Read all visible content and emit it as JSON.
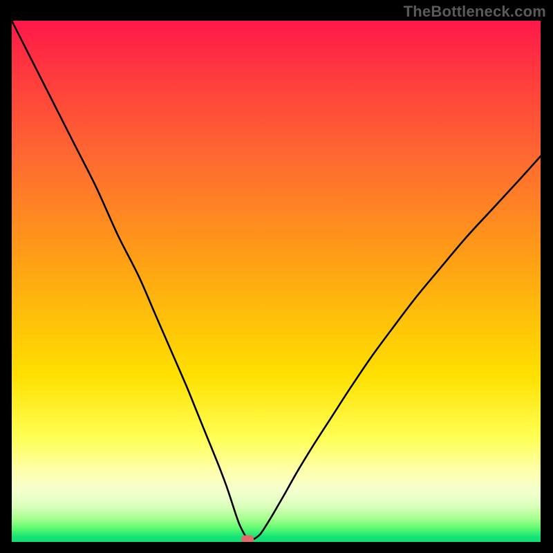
{
  "watermark": "TheBottleneck.com",
  "chart_data": {
    "type": "line",
    "title": "",
    "xlabel": "",
    "ylabel": "",
    "xlim": [
      0,
      100
    ],
    "ylim": [
      0,
      100
    ],
    "legend": false,
    "grid": false,
    "background_gradient": {
      "orientation": "vertical",
      "stops": [
        {
          "pos": 0.0,
          "color": "#ff184a"
        },
        {
          "pos": 0.12,
          "color": "#ff3f3c"
        },
        {
          "pos": 0.28,
          "color": "#ff6e2f"
        },
        {
          "pos": 0.46,
          "color": "#ffa015"
        },
        {
          "pos": 0.68,
          "color": "#ffe000"
        },
        {
          "pos": 0.8,
          "color": "#ffff55"
        },
        {
          "pos": 0.86,
          "color": "#ffffa8"
        },
        {
          "pos": 0.9,
          "color": "#f5ffcf"
        },
        {
          "pos": 0.93,
          "color": "#ddffbe"
        },
        {
          "pos": 0.955,
          "color": "#a8ff8f"
        },
        {
          "pos": 0.975,
          "color": "#59f96f"
        },
        {
          "pos": 0.99,
          "color": "#14e378"
        },
        {
          "pos": 1.0,
          "color": "#11df73"
        }
      ]
    },
    "series": [
      {
        "name": "bottleneck-curve",
        "color": "#000000",
        "x": [
          0,
          4,
          8,
          12,
          16,
          20,
          24,
          27,
          30,
          33,
          35,
          37,
          39,
          40.5,
          41.5,
          42.3,
          43.0,
          43.6,
          44.1,
          44.5,
          45.0,
          45.6,
          46.2,
          47.0,
          48.0,
          49.5,
          51.5,
          54.0,
          57.0,
          60.5,
          64.0,
          68.0,
          72.0,
          76.5,
          81.0,
          86.0,
          91.0,
          96.0,
          100.0
        ],
        "y": [
          100,
          92,
          84,
          76,
          68,
          59,
          51,
          44,
          37,
          30,
          25,
          20,
          15,
          11,
          8,
          5.5,
          3.5,
          2.2,
          1.3,
          0.7,
          0.5,
          0.5,
          0.8,
          1.5,
          3.0,
          5.5,
          9.0,
          13.5,
          18.5,
          24.0,
          29.5,
          35.5,
          41.0,
          47.0,
          52.5,
          58.5,
          64.0,
          69.5,
          74.0
        ]
      }
    ],
    "marker": {
      "name": "optimal-point",
      "x": 44.6,
      "y": 0.55,
      "color": "#e36a6a",
      "shape": "rounded-rect"
    }
  }
}
